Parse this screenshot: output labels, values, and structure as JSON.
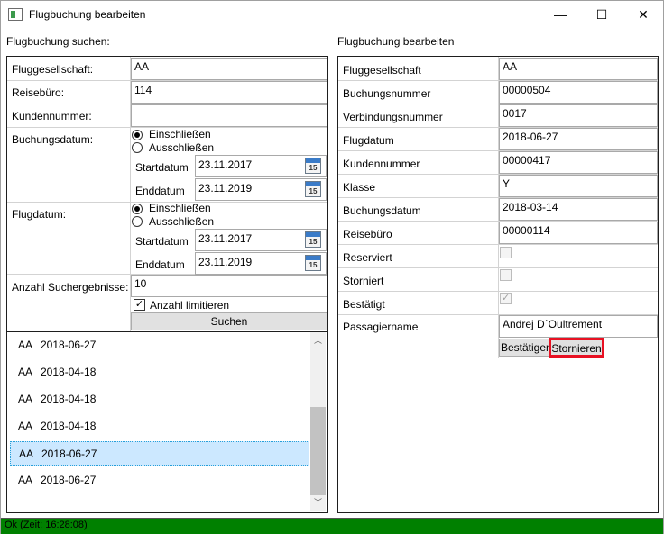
{
  "window": {
    "title": "Flugbuchung bearbeiten",
    "controls": {
      "minimize": "—",
      "maximize": "☐",
      "close": "✕"
    }
  },
  "search": {
    "heading": "Flugbuchung suchen:",
    "airline_label": "Fluggesellschaft:",
    "airline_value": "AA",
    "agency_label": "Reisebüro:",
    "agency_value": "114",
    "customer_label": "Kundennummer:",
    "customer_value": "",
    "booking_date_label": "Buchungsdatum:",
    "booking_include": "Einschließen",
    "booking_exclude": "Ausschließen",
    "booking_start_label": "Startdatum",
    "booking_start_value": "23.11.2017",
    "booking_end_label": "Enddatum",
    "booking_end_value": "23.11.2019",
    "flight_date_label": "Flugdatum:",
    "flight_include": "Einschließen",
    "flight_exclude": "Ausschließen",
    "flight_start_label": "Startdatum",
    "flight_start_value": "23.11.2017",
    "flight_end_label": "Enddatum",
    "flight_end_value": "23.11.2019",
    "result_count_label": "Anzahl Suchergebnisse:",
    "result_count_value": "10",
    "limit_label": "Anzahl limitieren",
    "limit_checked": true,
    "search_button": "Suchen",
    "calendar_day": "15"
  },
  "results": [
    {
      "airline": "AA",
      "date": "2018-06-27",
      "selected": false
    },
    {
      "airline": "AA",
      "date": "2018-04-18",
      "selected": false
    },
    {
      "airline": "AA",
      "date": "2018-04-18",
      "selected": false
    },
    {
      "airline": "AA",
      "date": "2018-04-18",
      "selected": false
    },
    {
      "airline": "AA",
      "date": "2018-06-27",
      "selected": true
    },
    {
      "airline": "AA",
      "date": "2018-06-27",
      "selected": false
    }
  ],
  "edit": {
    "heading": "Flugbuchung bearbeiten",
    "airline_label": "Fluggesellschaft",
    "airline_value": "AA",
    "booking_no_label": "Buchungsnummer",
    "booking_no_value": "00000504",
    "connection_label": "Verbindungsnummer",
    "connection_value": "0017",
    "flight_date_label": "Flugdatum",
    "flight_date_value": "2018-06-27",
    "customer_label": "Kundennummer",
    "customer_value": "00000417",
    "class_label": "Klasse",
    "class_value": "Y",
    "booking_date_label": "Buchungsdatum",
    "booking_date_value": "2018-03-14",
    "agency_label": "Reisebüro",
    "agency_value": "00000114",
    "reserved_label": "Reserviert",
    "cancelled_label": "Storniert",
    "confirmed_label": "Bestätigt",
    "passenger_label": "Passagiername",
    "passenger_value": "Andrej D´Oultrement",
    "confirm_button": "Bestätigen",
    "cancel_button": "Stornieren",
    "highlight_color": "#e81123"
  },
  "status": {
    "text": "Ok (Zeit: 16:28:08)",
    "color": "#008000"
  }
}
